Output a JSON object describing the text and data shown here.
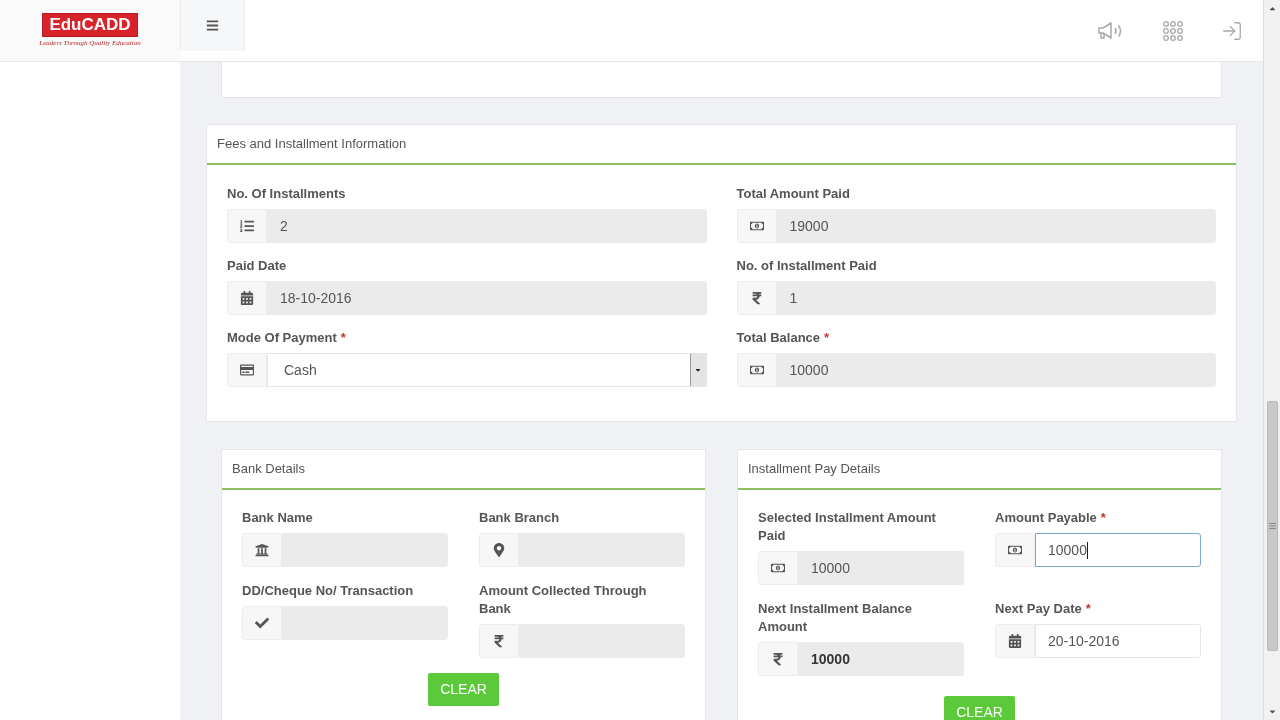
{
  "header": {
    "logo": {
      "text": "EduCADD",
      "tagline": "Leaders Through Quality Education"
    }
  },
  "fees_section": {
    "title": "Fees and Installment Information",
    "fields": [
      {
        "label": "No. Of Installments",
        "value": "2",
        "kind": "input",
        "readonly": true
      },
      {
        "label": "Total Amount Paid",
        "value": "19000",
        "kind": "input",
        "readonly": true
      },
      {
        "label": "Paid Date",
        "value": "18-10-2016",
        "kind": "input",
        "readonly": true
      },
      {
        "label": "No. of Installment Paid",
        "value": "1",
        "kind": "input",
        "readonly": true
      },
      {
        "label": "Mode Of Payment",
        "required_mark": "*",
        "value": "Cash",
        "kind": "select",
        "readonly": false
      },
      {
        "label": "Total Balance",
        "required_mark": "*",
        "value": "10000",
        "kind": "input",
        "readonly": true
      }
    ]
  },
  "bank_section": {
    "title": "Bank Details",
    "fields": [
      {
        "label": "Bank Name",
        "kind": "input",
        "readonly": true
      },
      {
        "label": "Bank Branch",
        "kind": "input",
        "readonly": true
      },
      {
        "label": "DD/Cheque No/ Transaction",
        "kind": "input",
        "readonly": true
      },
      {
        "label": "Amount Collected Through Bank",
        "kind": "input",
        "readonly": true
      }
    ],
    "button": "CLEAR"
  },
  "installment_section": {
    "title": "Installment Pay Details",
    "fields": [
      {
        "label": "Selected Installment Amount Paid",
        "value": "10000",
        "kind": "input",
        "readonly": true,
        "focused": false,
        "bold": false
      },
      {
        "label": "Amount Payable",
        "required_mark": "*",
        "value": "10000",
        "kind": "input",
        "readonly": false,
        "focused": true,
        "bold": false
      },
      {
        "label": "Next Installment Balance Amount",
        "value": "10000",
        "kind": "input",
        "readonly": true,
        "focused": false,
        "bold": true
      },
      {
        "label": "Next Pay Date",
        "required_mark": "*",
        "value": "20-10-2016",
        "kind": "input",
        "readonly": false,
        "focused": false,
        "bold": false
      }
    ],
    "button": "CLEAR"
  }
}
